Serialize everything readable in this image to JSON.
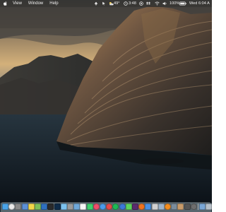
{
  "menubar": {
    "apple_icon": "apple-icon",
    "items": [
      {
        "label": "View"
      },
      {
        "label": "Window"
      },
      {
        "label": "Help"
      }
    ],
    "status": {
      "temperature": "49°",
      "time": "3:48",
      "battery_percent": "100%",
      "clock": "Wed 6:04 A"
    }
  },
  "dock": {
    "apps": [
      {
        "name": "finder-icon",
        "color": "#4aa3e8"
      },
      {
        "name": "chrome-icon",
        "color": "#e9e9e9"
      },
      {
        "name": "launchpad-icon",
        "color": "#8a8a8a"
      },
      {
        "name": "mail-icon",
        "color": "#5b8fd6"
      },
      {
        "name": "notes-icon",
        "color": "#f3d64a"
      },
      {
        "name": "photos-icon",
        "color": "#7fbf5a"
      },
      {
        "name": "app-store-icon",
        "color": "#2f6fbf"
      },
      {
        "name": "terminal-icon",
        "color": "#2a2a2a"
      },
      {
        "name": "photoshop-icon",
        "color": "#0f2b48"
      },
      {
        "name": "finder-alt-icon",
        "color": "#7bc2ef"
      },
      {
        "name": "settings-icon",
        "color": "#9a9a9a"
      },
      {
        "name": "preview-icon",
        "color": "#6fa8d9"
      },
      {
        "name": "calendar-icon",
        "color": "#f5f5f5"
      },
      {
        "name": "chat-icon",
        "color": "#3ecf6e"
      },
      {
        "name": "music-icon",
        "color": "#f04d6a"
      },
      {
        "name": "safari-icon",
        "color": "#4a9bea"
      },
      {
        "name": "blocked-icon",
        "color": "#e44a4a"
      },
      {
        "name": "spotify-icon",
        "color": "#1db954"
      },
      {
        "name": "globe-icon",
        "color": "#3c78d8"
      },
      {
        "name": "messages-icon",
        "color": "#5cd25c"
      },
      {
        "name": "slack-icon",
        "color": "#5a2b6e"
      },
      {
        "name": "firefox-icon",
        "color": "#f0731f"
      },
      {
        "name": "star-icon",
        "color": "#4a90e2"
      },
      {
        "name": "qr-icon",
        "color": "#d0d0d0"
      },
      {
        "name": "screenshot-icon",
        "color": "#9bb2c9"
      },
      {
        "name": "vlc-icon",
        "color": "#f28c1e"
      },
      {
        "name": "grid-icon",
        "color": "#7a8c9c"
      },
      {
        "name": "contacts-icon",
        "color": "#c89b6a"
      },
      {
        "name": "camera-icon",
        "color": "#555555"
      },
      {
        "name": "help-icon",
        "color": "#6d6d6d"
      }
    ],
    "trailing": [
      {
        "name": "downloads-icon",
        "color": "#7aa7d6"
      },
      {
        "name": "trash-icon",
        "color": "#b7c0c8"
      }
    ]
  }
}
